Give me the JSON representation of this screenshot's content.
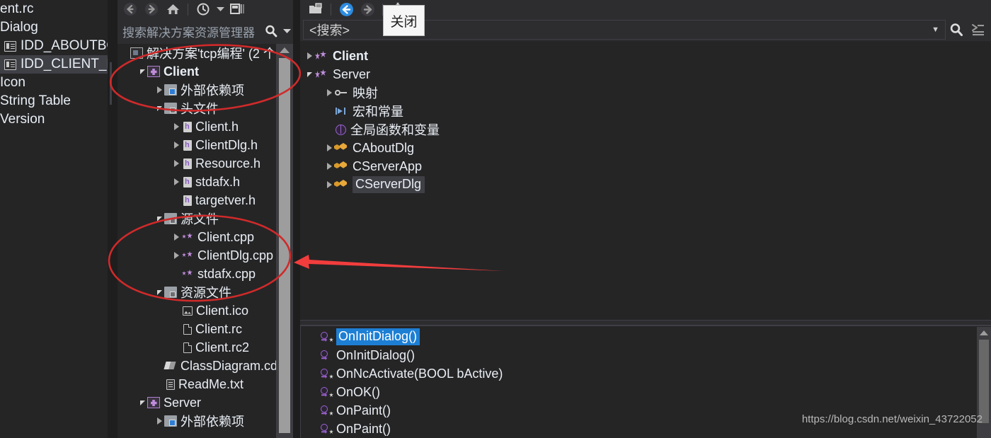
{
  "resource_view": {
    "items": [
      {
        "label": "ent.rc",
        "icon": "none",
        "indent": 0,
        "selected": false
      },
      {
        "label": "Dialog",
        "icon": "none",
        "indent": 0,
        "selected": false
      },
      {
        "label": "IDD_ABOUTBO",
        "icon": "dialog-icon",
        "indent": 1,
        "selected": false
      },
      {
        "label": "IDD_CLIENT_DI",
        "icon": "dialog-icon",
        "indent": 1,
        "selected": true
      },
      {
        "label": "Icon",
        "icon": "none",
        "indent": 0,
        "selected": false
      },
      {
        "label": "String Table",
        "icon": "none",
        "indent": 0,
        "selected": false
      },
      {
        "label": "Version",
        "icon": "none",
        "indent": 0,
        "selected": false
      }
    ]
  },
  "solution_explorer": {
    "toolbar": {
      "back": "back-icon",
      "forward": "forward-icon",
      "home": "home-icon",
      "pending_changes": "pending-changes-icon",
      "dropdown": "chevron-down-icon",
      "properties": "properties-icon"
    },
    "search": {
      "placeholder": "搜索解决方案资源管理器",
      "value": "",
      "search_icon": "search-icon",
      "caret": "chevron-down-icon"
    },
    "tree": [
      {
        "label": "解决方案'tcp编程' (2 个",
        "icon": "solution-icon",
        "indent": 0,
        "twisty": "none",
        "bold": false
      },
      {
        "label": "Client",
        "icon": "project-icon",
        "indent": 1,
        "twisty": "down",
        "bold": true
      },
      {
        "label": "外部依赖项",
        "icon": "external-dependencies-icon",
        "indent": 2,
        "twisty": "right",
        "bold": false
      },
      {
        "label": "头文件",
        "icon": "filter-folder-icon",
        "indent": 2,
        "twisty": "down",
        "bold": false
      },
      {
        "label": "Client.h",
        "icon": "header-file-icon",
        "indent": 3,
        "twisty": "right",
        "bold": false
      },
      {
        "label": "ClientDlg.h",
        "icon": "header-file-icon",
        "indent": 3,
        "twisty": "right",
        "bold": false
      },
      {
        "label": "Resource.h",
        "icon": "header-file-icon",
        "indent": 3,
        "twisty": "right",
        "bold": false
      },
      {
        "label": "stdafx.h",
        "icon": "header-file-icon",
        "indent": 3,
        "twisty": "right",
        "bold": false
      },
      {
        "label": "targetver.h",
        "icon": "header-file-icon",
        "indent": 3,
        "twisty": "none",
        "bold": false
      },
      {
        "label": "源文件",
        "icon": "filter-folder-icon",
        "indent": 2,
        "twisty": "down",
        "bold": false
      },
      {
        "label": "Client.cpp",
        "icon": "cpp-file-icon",
        "indent": 3,
        "twisty": "right",
        "bold": false
      },
      {
        "label": "ClientDlg.cpp",
        "icon": "cpp-file-icon",
        "indent": 3,
        "twisty": "right",
        "bold": false
      },
      {
        "label": "stdafx.cpp",
        "icon": "cpp-file-icon",
        "indent": 3,
        "twisty": "none",
        "bold": false
      },
      {
        "label": "资源文件",
        "icon": "filter-folder-icon",
        "indent": 2,
        "twisty": "down",
        "bold": false
      },
      {
        "label": "Client.ico",
        "icon": "image-file-icon",
        "indent": 3,
        "twisty": "none",
        "bold": false
      },
      {
        "label": "Client.rc",
        "icon": "resource-file-icon",
        "indent": 3,
        "twisty": "none",
        "bold": false
      },
      {
        "label": "Client.rc2",
        "icon": "resource-file-icon",
        "indent": 3,
        "twisty": "none",
        "bold": false
      },
      {
        "label": "ClassDiagram.cd",
        "icon": "class-diagram-icon",
        "indent": 2,
        "twisty": "none",
        "bold": false
      },
      {
        "label": "ReadMe.txt",
        "icon": "text-file-icon",
        "indent": 2,
        "twisty": "none",
        "bold": false
      },
      {
        "label": "Server",
        "icon": "project-icon",
        "indent": 1,
        "twisty": "down",
        "bold": false
      },
      {
        "label": "外部依赖项",
        "icon": "external-dependencies-icon",
        "indent": 2,
        "twisty": "right",
        "bold": false
      }
    ]
  },
  "class_view": {
    "toolbar": {
      "new_folder": "new-folder-icon",
      "back": "back-icon",
      "forward": "forward-icon",
      "settings": "gear-icon",
      "dropdown": "chevron-down-icon"
    },
    "search": {
      "value": "<搜索>",
      "caret": "chevron-down-icon",
      "search_icon": "search-icon",
      "sort_icon": "sort-icon"
    },
    "tree": [
      {
        "label": "Client",
        "icon": "namespace-icon",
        "indent": 0,
        "twisty": "right",
        "bold": true,
        "selected": false
      },
      {
        "label": "Server",
        "icon": "namespace-icon",
        "indent": 0,
        "twisty": "down",
        "bold": false,
        "selected": false
      },
      {
        "label": "映射",
        "icon": "key-icon",
        "indent": 1,
        "twisty": "right",
        "bold": false,
        "selected": false
      },
      {
        "label": "宏和常量",
        "icon": "macro-icon",
        "indent": 1,
        "twisty": "none",
        "bold": false,
        "selected": false
      },
      {
        "label": "全局函数和变量",
        "icon": "globe-icon",
        "indent": 1,
        "twisty": "none",
        "bold": false,
        "selected": false
      },
      {
        "label": "CAboutDlg",
        "icon": "class-icon",
        "indent": 1,
        "twisty": "right",
        "bold": false,
        "selected": false
      },
      {
        "label": "CServerApp",
        "icon": "class-icon",
        "indent": 1,
        "twisty": "right",
        "bold": false,
        "selected": false
      },
      {
        "label": "CServerDlg",
        "icon": "class-icon",
        "indent": 1,
        "twisty": "right",
        "bold": false,
        "selected": true
      }
    ],
    "members": [
      {
        "label": "OnInitDialog()",
        "icon": "method-protected-icon",
        "selected": true
      },
      {
        "label": "OnInitDialog()",
        "icon": "method-icon",
        "selected": false
      },
      {
        "label": "OnNcActivate(BOOL bActive)",
        "icon": "method-protected-icon",
        "selected": false
      },
      {
        "label": "OnOK()",
        "icon": "method-protected-icon",
        "selected": false
      },
      {
        "label": "OnPaint()",
        "icon": "method-protected-icon",
        "selected": false
      },
      {
        "label": "OnPaint()",
        "icon": "method-protected-icon",
        "selected": false
      }
    ]
  },
  "tooltip": {
    "text": "关闭"
  },
  "watermark": {
    "text": "https://blog.csdn.net/weixin_43722052"
  },
  "annotations": {
    "color": "#e03030",
    "arrow_color": "#f23d3d",
    "shapes": [
      "ellipse-around-client-project",
      "ellipse-around-source-files",
      "left-pointing-arrow"
    ]
  }
}
